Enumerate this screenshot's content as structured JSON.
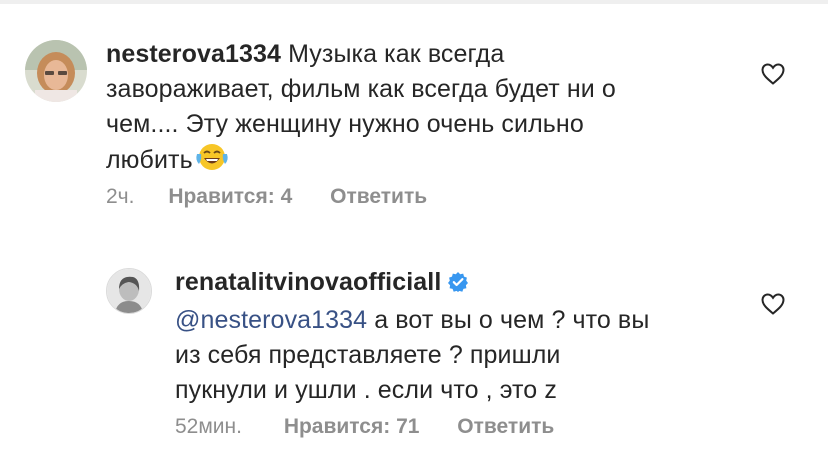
{
  "comments": [
    {
      "username": "nesterova1334",
      "text_line1": "Музыка как всегда",
      "text_line2": "завораживает, фильм как всегда будет ни о",
      "text_line3": "чем.... Эту женщину нужно очень сильно",
      "text_line4": "любить",
      "emoji": "tears-of-joy-emoji",
      "time": "2ч.",
      "likes": "Нравится: 4",
      "reply": "Ответить",
      "like_icon": "heart-outline-icon"
    },
    {
      "username": "renatalitvinovaofficiall",
      "verified_icon": "verified-badge-icon",
      "mention": "@nesterova1334",
      "text_line1_rest": " а вот вы о чем ? что вы",
      "text_line2": "из себя представляете ?  пришли",
      "text_line3": "пукнули и ушли . если что , это z",
      "time": "52мин.",
      "likes": "Нравится: 71",
      "reply": "Ответить",
      "like_icon": "heart-outline-icon"
    }
  ],
  "colors": {
    "text": "#262626",
    "secondary": "#8e8e8e",
    "mention": "#385185",
    "verified": "#3897f0"
  }
}
